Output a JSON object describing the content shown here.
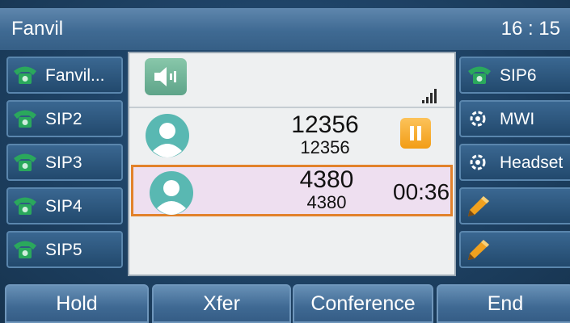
{
  "status_bar": {
    "brand": "Fanvil",
    "time": "16 : 15"
  },
  "left_keys": [
    {
      "label": "Fanvil...",
      "icon": "phone-icon"
    },
    {
      "label": "SIP2",
      "icon": "phone-icon"
    },
    {
      "label": "SIP3",
      "icon": "phone-icon"
    },
    {
      "label": "SIP4",
      "icon": "phone-icon"
    },
    {
      "label": "SIP5",
      "icon": "phone-icon"
    }
  ],
  "right_keys": [
    {
      "label": "SIP6",
      "icon": "phone-icon"
    },
    {
      "label": "MWI",
      "icon": "mwi-icon"
    },
    {
      "label": "Headset",
      "icon": "headset-icon"
    },
    {
      "label": "",
      "icon": "pencil-icon"
    },
    {
      "label": "",
      "icon": "pencil-icon"
    }
  ],
  "call_panel": {
    "audio_mode_icon": "speaker-icon",
    "signal_icon": "signal-bars-icon",
    "calls": [
      {
        "number": "12356",
        "name": "12356",
        "state": "held",
        "state_icon": "pause-icon"
      },
      {
        "number": "4380",
        "name": "4380",
        "state": "active",
        "duration": "00:36"
      }
    ]
  },
  "softkeys": [
    "Hold",
    "Xfer",
    "Conference",
    "End"
  ],
  "colors": {
    "phone_icon_green": "#27a35a",
    "active_call_border": "#e2822b",
    "active_call_bg": "#eedff0",
    "hold_icon": "#f4a522"
  }
}
